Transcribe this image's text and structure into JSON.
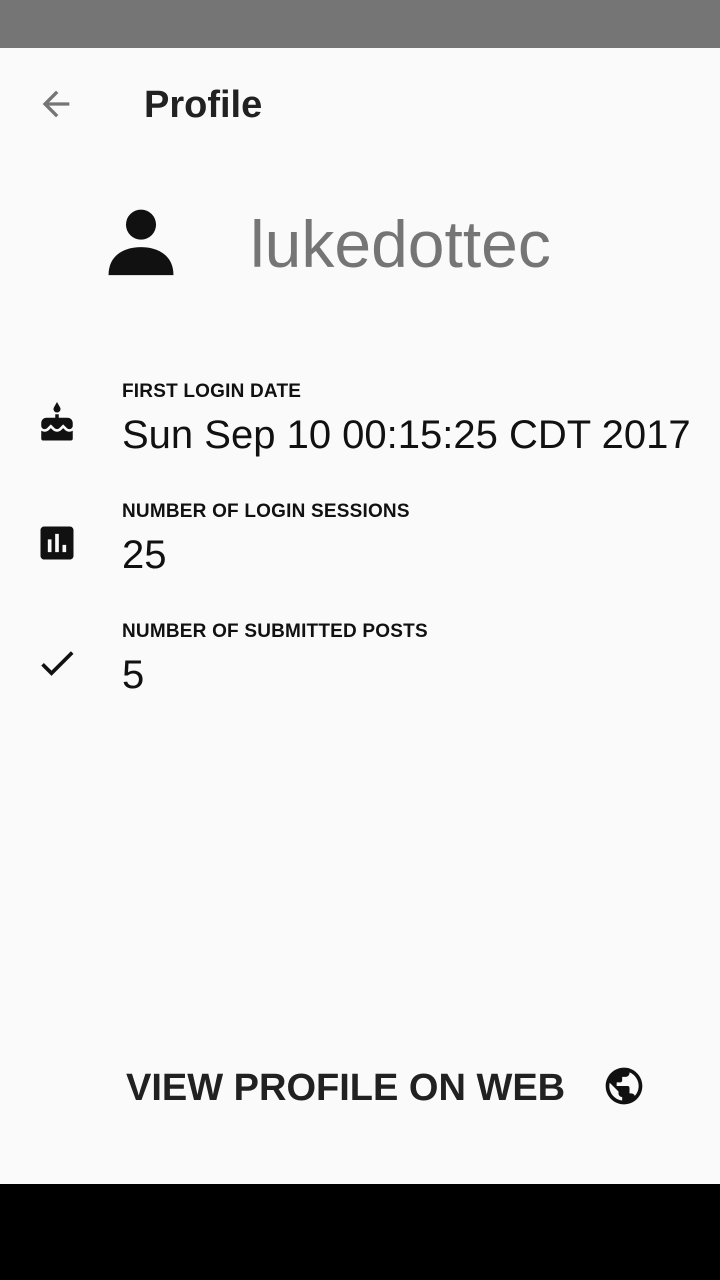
{
  "app_bar": {
    "title": "Profile",
    "back_icon": "arrow-left-icon"
  },
  "user": {
    "avatar_icon": "person-icon",
    "username": "lukedottec"
  },
  "stats": [
    {
      "icon": "cake-icon",
      "label": "FIRST LOGIN DATE",
      "value": "Sun Sep 10 00:15:25 CDT 2017"
    },
    {
      "icon": "bar-chart-icon",
      "label": "NUMBER OF LOGIN SESSIONS",
      "value": "25"
    },
    {
      "icon": "check-icon",
      "label": "NUMBER OF SUBMITTED POSTS",
      "value": "5"
    }
  ],
  "web_action": {
    "label": "VIEW PROFILE ON WEB",
    "icon": "globe-icon"
  },
  "colors": {
    "status_bar": "#757575",
    "background": "#fafafa",
    "username": "#757575",
    "nav_bar": "#000000"
  }
}
